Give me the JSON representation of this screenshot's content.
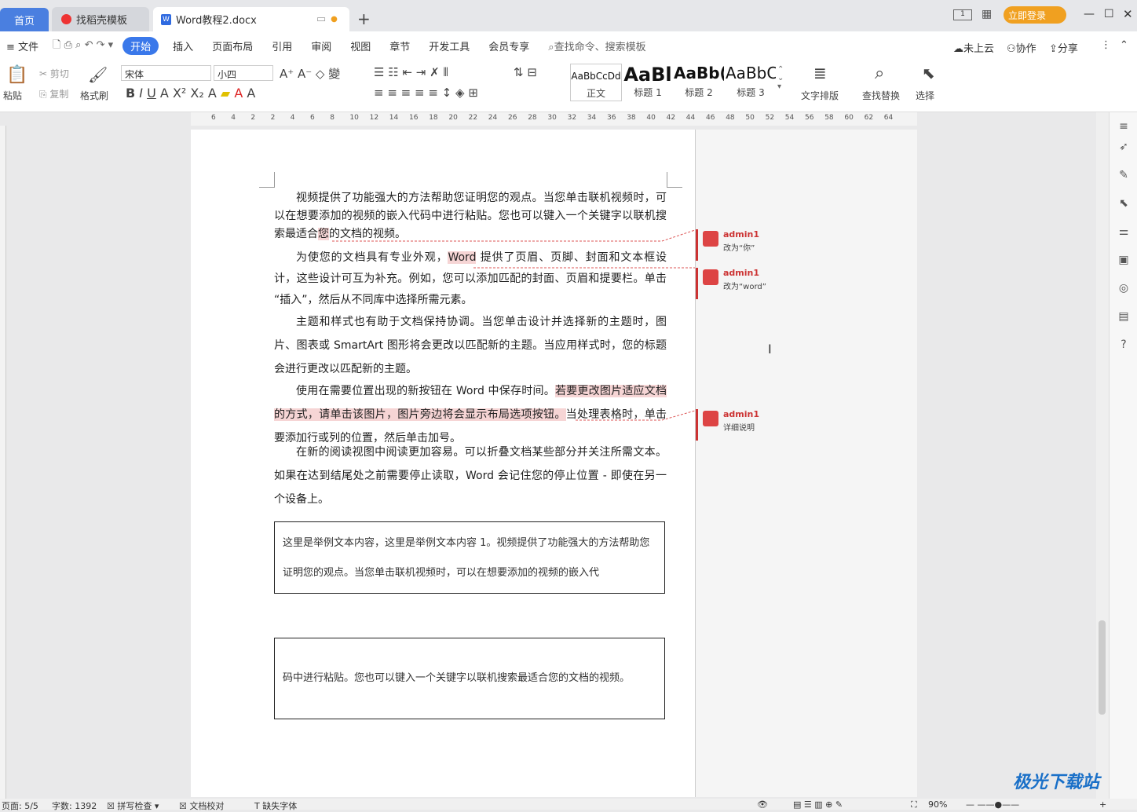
{
  "tabs": {
    "home": "首页",
    "template": "找稻壳模板",
    "doc": "Word教程2.docx"
  },
  "titlebar": {
    "login": "立即登录"
  },
  "menu": {
    "file": "文件",
    "items": [
      "开始",
      "插入",
      "页面布局",
      "引用",
      "审阅",
      "视图",
      "章节",
      "开发工具",
      "会员专享"
    ],
    "search": "查找命令、搜索模板",
    "cloud": "未上云",
    "collab": "协作",
    "share": "分享"
  },
  "ribbon": {
    "paste": "粘贴",
    "cut": "剪切",
    "copy": "复制",
    "format_painter": "格式刷",
    "font": "宋体",
    "size": "小四",
    "styles": [
      {
        "preview": "AaBbCcDd",
        "label": "正文"
      },
      {
        "preview": "AaBl",
        "label": "标题 1"
      },
      {
        "preview": "AaBb(",
        "label": "标题 2"
      },
      {
        "preview": "AaBbC",
        "label": "标题 3"
      }
    ],
    "text_layout": "文字排版",
    "find_replace": "查找替换",
    "select": "选择"
  },
  "ruler": [
    "6",
    "4",
    "2",
    "2",
    "4",
    "6",
    "8",
    "10",
    "12",
    "14",
    "16",
    "18",
    "20",
    "22",
    "24",
    "26",
    "28",
    "30",
    "32",
    "34",
    "36",
    "38",
    "40",
    "42",
    "44",
    "46",
    "48",
    "50",
    "52",
    "54",
    "56",
    "58",
    "60",
    "62",
    "64"
  ],
  "doc": {
    "p1a": "视频提供了功能强大的方法帮助您证明您的观点。当您单击联机视频时，可以在想要添加的视频的嵌入代码中进行粘贴。您也可以键入一个关键字以联机搜索最适合",
    "p1hl": "您",
    "p1b": "的文档的视频。",
    "p2a": "为使您的文档具有专业外观，",
    "p2hl": "Word",
    "p2b": " 提供了页眉、页脚、封面和文本框设计，这些设计可互为补充。例如，您可以添加匹配的封面、页眉和提要栏。单击 “插入”，然后从不同库中选择所需元素。",
    "p3": "主题和样式也有助于文档保持协调。当您单击设计并选择新的主题时，图片、图表或 SmartArt 图形将会更改以匹配新的主题。当应用样式时，您的标题会进行更改以匹配新的主题。",
    "p4a": "使用在需要位置出现的新按钮在 Word 中保存时间。",
    "p4hl": "若要更改图片适应文档的方式，请单击该图片，图片旁边将会显示布局选项按钮。",
    "p4b": "当处理表格时，单击要添加行或列的位置，然后单击加号。",
    "p5": "在新的阅读视图中阅读更加容易。可以折叠文档某些部分并关注所需文本。如果在达到结尾处之前需要停止读取，Word 会记住您的停止位置 - 即使在另一个设备上。",
    "box1": "这里是举例文本内容，这里是举例文本内容 1。视频提供了功能强大的方法帮助您证明您的观点。当您单击联机视频时，可以在想要添加的视频的嵌入代",
    "box2": "码中进行粘贴。您也可以键入一个关键字以联机搜索最适合您的文档的视频。"
  },
  "comments": [
    {
      "author": "admin1",
      "text": "改为“你”"
    },
    {
      "author": "admin1",
      "text": "改为“word”"
    },
    {
      "author": "admin1",
      "text": "详细说明"
    }
  ],
  "status": {
    "page": "页面: 5/5",
    "words": "字数: 1392",
    "spell": "拼写检查",
    "proof": "文档校对",
    "font_missing": "缺失字体",
    "zoom": "90%"
  },
  "watermark": "极光下载站"
}
